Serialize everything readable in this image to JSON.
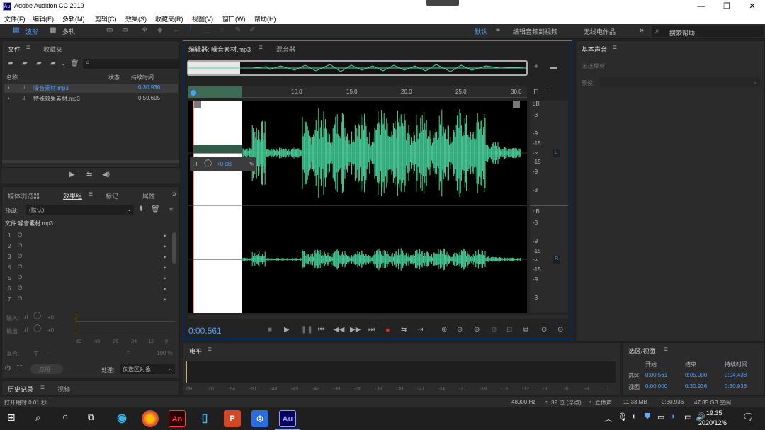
{
  "window": {
    "title": "Adobe Audition CC 2019",
    "logo": "Au",
    "minimize": "—",
    "maximize": "❐",
    "close": "✕"
  },
  "menu": [
    "文件(F)",
    "编辑(E)",
    "多轨(M)",
    "剪辑(C)",
    "效果(S)",
    "收藏夹(R)",
    "视图(V)",
    "窗口(W)",
    "帮助(H)"
  ],
  "toolbar": {
    "waveform": "波形",
    "multitrack": "多轨",
    "workspace_default": "默认",
    "workspace_edit_video": "编辑音频到视频",
    "workspace_radio": "无线电作品",
    "more": "»",
    "search_placeholder": "搜索帮助"
  },
  "files_panel": {
    "tabs": [
      "文件",
      "收藏夹"
    ],
    "headers": {
      "name": "名称 ↑",
      "status": "状态",
      "duration": "持续时间"
    },
    "files": [
      {
        "name": "噪音素材.mp3",
        "duration": "0:30.936"
      },
      {
        "name": "特殊效果素材.mp3",
        "duration": "0:59.605"
      }
    ]
  },
  "effects_panel": {
    "tabs": [
      "媒体浏览器",
      "效果组",
      "标记",
      "属性"
    ],
    "preset_label": "预设:",
    "preset_value": "(默认)",
    "file_label": "文件:噪音素材.mp3",
    "slots": [
      "1",
      "2",
      "3",
      "4",
      "5",
      "6",
      "7"
    ],
    "input_label": "输入:",
    "output_label": "输出:",
    "gain": "+0",
    "meter_ticks": [
      "dB",
      "-48",
      "-36",
      "-24",
      "-12",
      "0"
    ],
    "mix_label": "混合:",
    "mix_dry": "干",
    "mix_percent": "100 %",
    "apply": "应用",
    "process_label": "处理:",
    "process_value": "仅选区对象"
  },
  "history": {
    "tabs": [
      "历史记录",
      "视频"
    ]
  },
  "editor": {
    "tabs": [
      "编辑器: 噪音素材.mp3",
      "混音器"
    ],
    "ruler": [
      "10.0",
      "15.0",
      "20.0",
      "25.0",
      "30.0"
    ],
    "hud_gain": "+0 dB",
    "db_top": [
      "dB",
      "-3",
      "-9",
      "-15",
      "-∞",
      "-15",
      "-9",
      "-3"
    ],
    "db_bottom": [
      "dB",
      "-3",
      "-9",
      "-15",
      "-∞",
      "-15",
      "-9",
      "-3"
    ],
    "channel_left": "L",
    "channel_right": "R",
    "time": "0:00.561"
  },
  "essential_sound": {
    "title": "基本声音",
    "none_selected": "无选择项",
    "preset_label": "预设:"
  },
  "level_panel": {
    "title": "电平",
    "scale": [
      "dB",
      "-57",
      "-54",
      "-51",
      "-48",
      "-45",
      "-42",
      "-39",
      "-36",
      "-33",
      "-30",
      "-27",
      "-24",
      "-21",
      "-18",
      "-15",
      "-12",
      "-9",
      "-6",
      "-3",
      "0"
    ]
  },
  "selection_view": {
    "title": "选区/视图",
    "cols": [
      "开始",
      "结束",
      "持续时间"
    ],
    "selection_label": "选区",
    "view_label": "视图",
    "selection": [
      "0:00.561",
      "0:05.000",
      "0:04.438"
    ],
    "view": [
      "0:00.000",
      "0:30.936",
      "0:30.936"
    ]
  },
  "status": {
    "left": "打开用时 0.01 秒",
    "sample_rate": "48000 Hz",
    "bit": "32 位 (浮点)",
    "channels": "立体声",
    "size": "11.33 MB",
    "duration": "0:30.936",
    "free": "47.85 GB 空闲"
  },
  "taskbar": {
    "time": "19:35",
    "date": "2020/12/6",
    "ime": "中"
  },
  "colors": {
    "accent": "#3d7bd9",
    "wave": "#4ad9a0",
    "time_blue": "#4aa3ff"
  }
}
